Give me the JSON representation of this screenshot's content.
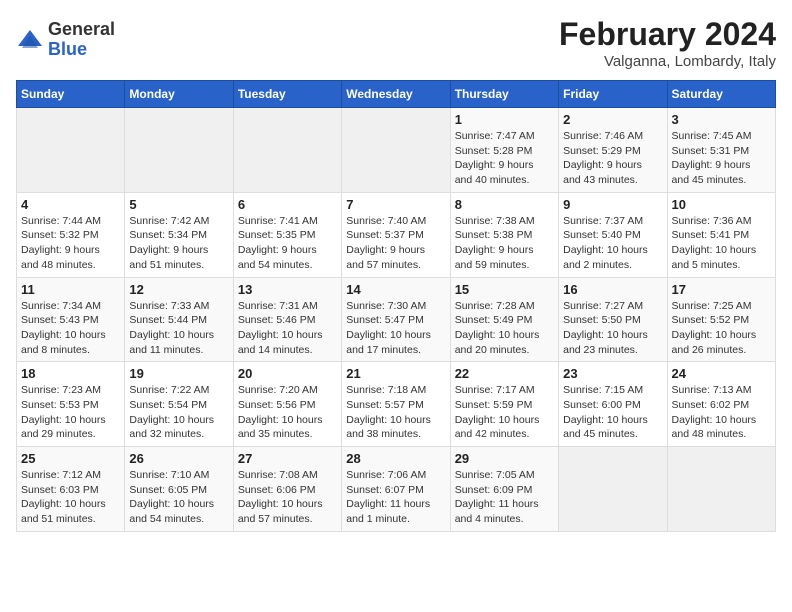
{
  "header": {
    "logo": {
      "general": "General",
      "blue": "Blue"
    },
    "title": "February 2024",
    "subtitle": "Valganna, Lombardy, Italy"
  },
  "weekdays": [
    "Sunday",
    "Monday",
    "Tuesday",
    "Wednesday",
    "Thursday",
    "Friday",
    "Saturday"
  ],
  "weeks": [
    [
      {
        "day": "",
        "info": ""
      },
      {
        "day": "",
        "info": ""
      },
      {
        "day": "",
        "info": ""
      },
      {
        "day": "",
        "info": ""
      },
      {
        "day": "1",
        "info": "Sunrise: 7:47 AM\nSunset: 5:28 PM\nDaylight: 9 hours\nand 40 minutes."
      },
      {
        "day": "2",
        "info": "Sunrise: 7:46 AM\nSunset: 5:29 PM\nDaylight: 9 hours\nand 43 minutes."
      },
      {
        "day": "3",
        "info": "Sunrise: 7:45 AM\nSunset: 5:31 PM\nDaylight: 9 hours\nand 45 minutes."
      }
    ],
    [
      {
        "day": "4",
        "info": "Sunrise: 7:44 AM\nSunset: 5:32 PM\nDaylight: 9 hours\nand 48 minutes."
      },
      {
        "day": "5",
        "info": "Sunrise: 7:42 AM\nSunset: 5:34 PM\nDaylight: 9 hours\nand 51 minutes."
      },
      {
        "day": "6",
        "info": "Sunrise: 7:41 AM\nSunset: 5:35 PM\nDaylight: 9 hours\nand 54 minutes."
      },
      {
        "day": "7",
        "info": "Sunrise: 7:40 AM\nSunset: 5:37 PM\nDaylight: 9 hours\nand 57 minutes."
      },
      {
        "day": "8",
        "info": "Sunrise: 7:38 AM\nSunset: 5:38 PM\nDaylight: 9 hours\nand 59 minutes."
      },
      {
        "day": "9",
        "info": "Sunrise: 7:37 AM\nSunset: 5:40 PM\nDaylight: 10 hours\nand 2 minutes."
      },
      {
        "day": "10",
        "info": "Sunrise: 7:36 AM\nSunset: 5:41 PM\nDaylight: 10 hours\nand 5 minutes."
      }
    ],
    [
      {
        "day": "11",
        "info": "Sunrise: 7:34 AM\nSunset: 5:43 PM\nDaylight: 10 hours\nand 8 minutes."
      },
      {
        "day": "12",
        "info": "Sunrise: 7:33 AM\nSunset: 5:44 PM\nDaylight: 10 hours\nand 11 minutes."
      },
      {
        "day": "13",
        "info": "Sunrise: 7:31 AM\nSunset: 5:46 PM\nDaylight: 10 hours\nand 14 minutes."
      },
      {
        "day": "14",
        "info": "Sunrise: 7:30 AM\nSunset: 5:47 PM\nDaylight: 10 hours\nand 17 minutes."
      },
      {
        "day": "15",
        "info": "Sunrise: 7:28 AM\nSunset: 5:49 PM\nDaylight: 10 hours\nand 20 minutes."
      },
      {
        "day": "16",
        "info": "Sunrise: 7:27 AM\nSunset: 5:50 PM\nDaylight: 10 hours\nand 23 minutes."
      },
      {
        "day": "17",
        "info": "Sunrise: 7:25 AM\nSunset: 5:52 PM\nDaylight: 10 hours\nand 26 minutes."
      }
    ],
    [
      {
        "day": "18",
        "info": "Sunrise: 7:23 AM\nSunset: 5:53 PM\nDaylight: 10 hours\nand 29 minutes."
      },
      {
        "day": "19",
        "info": "Sunrise: 7:22 AM\nSunset: 5:54 PM\nDaylight: 10 hours\nand 32 minutes."
      },
      {
        "day": "20",
        "info": "Sunrise: 7:20 AM\nSunset: 5:56 PM\nDaylight: 10 hours\nand 35 minutes."
      },
      {
        "day": "21",
        "info": "Sunrise: 7:18 AM\nSunset: 5:57 PM\nDaylight: 10 hours\nand 38 minutes."
      },
      {
        "day": "22",
        "info": "Sunrise: 7:17 AM\nSunset: 5:59 PM\nDaylight: 10 hours\nand 42 minutes."
      },
      {
        "day": "23",
        "info": "Sunrise: 7:15 AM\nSunset: 6:00 PM\nDaylight: 10 hours\nand 45 minutes."
      },
      {
        "day": "24",
        "info": "Sunrise: 7:13 AM\nSunset: 6:02 PM\nDaylight: 10 hours\nand 48 minutes."
      }
    ],
    [
      {
        "day": "25",
        "info": "Sunrise: 7:12 AM\nSunset: 6:03 PM\nDaylight: 10 hours\nand 51 minutes."
      },
      {
        "day": "26",
        "info": "Sunrise: 7:10 AM\nSunset: 6:05 PM\nDaylight: 10 hours\nand 54 minutes."
      },
      {
        "day": "27",
        "info": "Sunrise: 7:08 AM\nSunset: 6:06 PM\nDaylight: 10 hours\nand 57 minutes."
      },
      {
        "day": "28",
        "info": "Sunrise: 7:06 AM\nSunset: 6:07 PM\nDaylight: 11 hours\nand 1 minute."
      },
      {
        "day": "29",
        "info": "Sunrise: 7:05 AM\nSunset: 6:09 PM\nDaylight: 11 hours\nand 4 minutes."
      },
      {
        "day": "",
        "info": ""
      },
      {
        "day": "",
        "info": ""
      }
    ]
  ]
}
